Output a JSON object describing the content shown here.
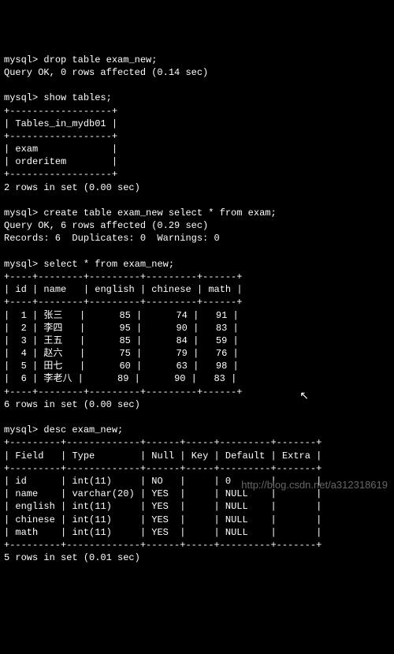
{
  "prompt": "mysql>",
  "commands": {
    "drop": "drop table exam_new;",
    "drop_result": "Query OK, 0 rows affected (0.14 sec)",
    "show": "show tables;",
    "create": "create table exam_new select * from exam;",
    "create_result": "Query OK, 6 rows affected (0.29 sec)",
    "create_records": "Records: 6  Duplicates: 0  Warnings: 0",
    "select": "select * from exam_new;",
    "desc": "desc exam_new;"
  },
  "show_tables": {
    "header": "Tables_in_mydb01",
    "rows": [
      "exam",
      "orderitem"
    ],
    "footer": "2 rows in set (0.00 sec)"
  },
  "select_result": {
    "columns": [
      "id",
      "name",
      "english",
      "chinese",
      "math"
    ],
    "rows": [
      {
        "id": "1",
        "name": "张三",
        "english": "85",
        "chinese": "74",
        "math": "91"
      },
      {
        "id": "2",
        "name": "李四",
        "english": "95",
        "chinese": "90",
        "math": "83"
      },
      {
        "id": "3",
        "name": "王五",
        "english": "85",
        "chinese": "84",
        "math": "59"
      },
      {
        "id": "4",
        "name": "赵六",
        "english": "75",
        "chinese": "79",
        "math": "76"
      },
      {
        "id": "5",
        "name": "田七",
        "english": "60",
        "chinese": "63",
        "math": "98"
      },
      {
        "id": "6",
        "name": "李老八",
        "english": "89",
        "chinese": "90",
        "math": "83"
      }
    ],
    "footer": "6 rows in set (0.00 sec)"
  },
  "desc_result": {
    "columns": [
      "Field",
      "Type",
      "Null",
      "Key",
      "Default",
      "Extra"
    ],
    "rows": [
      {
        "field": "id",
        "type": "int(11)",
        "null": "NO",
        "key": "",
        "default": "0",
        "extra": ""
      },
      {
        "field": "name",
        "type": "varchar(20)",
        "null": "YES",
        "key": "",
        "default": "NULL",
        "extra": ""
      },
      {
        "field": "english",
        "type": "int(11)",
        "null": "YES",
        "key": "",
        "default": "NULL",
        "extra": ""
      },
      {
        "field": "chinese",
        "type": "int(11)",
        "null": "YES",
        "key": "",
        "default": "NULL",
        "extra": ""
      },
      {
        "field": "math",
        "type": "int(11)",
        "null": "YES",
        "key": "",
        "default": "NULL",
        "extra": ""
      }
    ],
    "footer": "5 rows in set (0.01 sec)"
  },
  "watermark": "http://blog.csdn.net/a312318619"
}
